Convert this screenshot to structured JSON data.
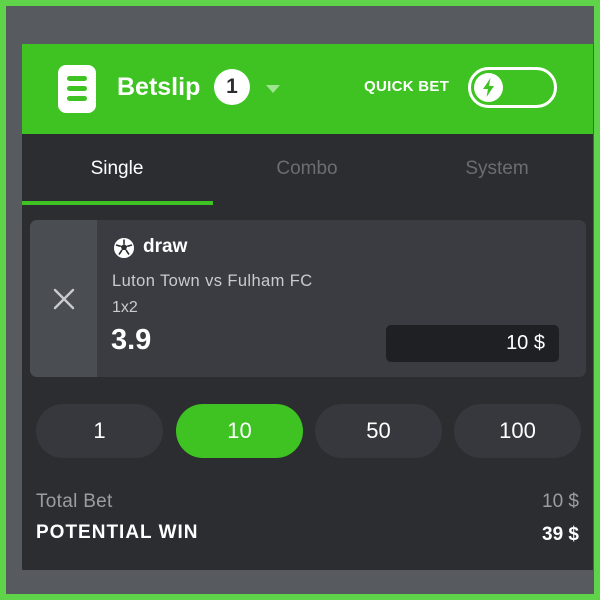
{
  "header": {
    "title": "Betslip",
    "count": "1",
    "quick_bet_label": "QUICK BET",
    "quick_bet_enabled": false,
    "accent_color": "#3ec322"
  },
  "tabs": [
    {
      "label": "Single",
      "active": true
    },
    {
      "label": "Combo",
      "active": false
    },
    {
      "label": "System",
      "active": false
    }
  ],
  "bet": {
    "sport_icon": "soccer-ball-icon",
    "selection": "draw",
    "match": "Luton Town vs Fulham FC",
    "market": "1x2",
    "odds": "3.9",
    "stake": "10 $"
  },
  "quick_amounts": [
    {
      "label": "1",
      "active": false
    },
    {
      "label": "10",
      "active": true
    },
    {
      "label": "50",
      "active": false
    },
    {
      "label": "100",
      "active": false
    }
  ],
  "summary": {
    "total_bet_label": "Total Bet",
    "total_bet_value": "10 $",
    "potential_win_label": "POTENTIAL WIN",
    "potential_win_value": "39 $"
  }
}
